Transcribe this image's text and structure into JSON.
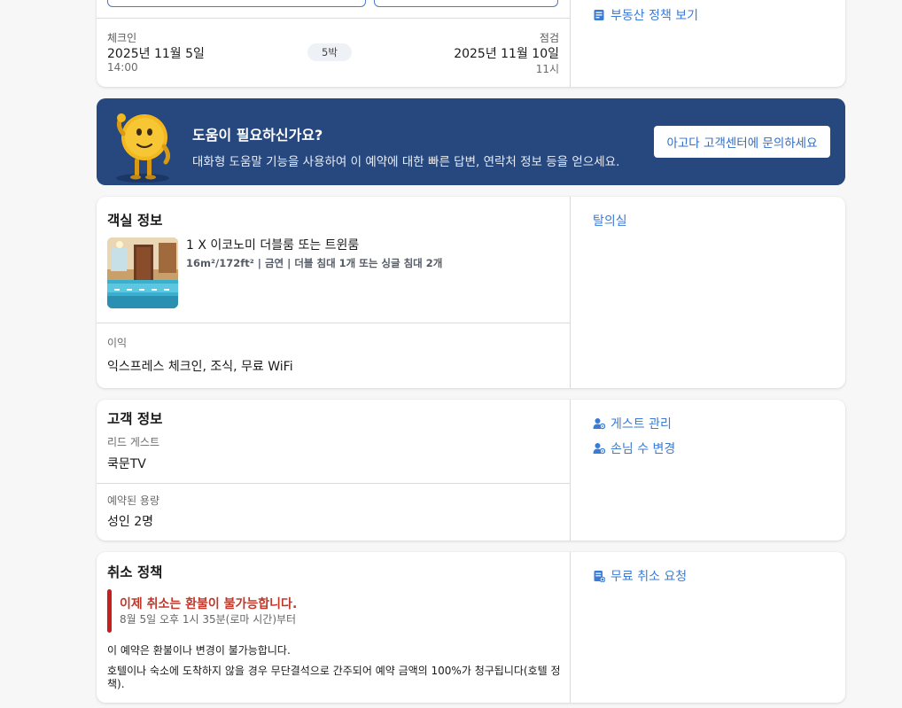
{
  "stay": {
    "property_policy_link": "부동산 정책 보기",
    "checkin_label": "체크인",
    "checkin_date": "2025년 11월 5일",
    "checkin_time": "14:00",
    "nights": "5박",
    "checkout_label": "점검",
    "checkout_date": "2025년 11월 10일",
    "checkout_time": "11시"
  },
  "help": {
    "title": "도움이 필요하신가요?",
    "description": "대화형 도움말 기능을 사용하여 이 예약에 대한 빠른 답변, 연락처 정보 등을 얻으세요.",
    "cta": "아고다 고객센터에 문의하세요"
  },
  "room": {
    "section_title": "객실 정보",
    "name": "1 X 이코노미 더블룸 또는 트윈룸",
    "spec": "16m²/172ft² | 금연 | 더블 침대 1개 또는 싱글 침대 2개",
    "benefits_label": "이익",
    "benefits": "익스프레스 체크인, 조식, 무료 WiFi",
    "side_link": "탈의실"
  },
  "guest": {
    "section_title": "고객 정보",
    "lead_label": "리드 게스트",
    "lead_name": "쿡문TV",
    "capacity_label": "예약된 용량",
    "capacity": "성인 2명",
    "manage_link": "게스트 관리",
    "change_count_link": "손님 수 변경"
  },
  "cancel": {
    "section_title": "취소 정책",
    "alert_title": "이제 취소는 환불이 불가능합니다.",
    "alert_sub": "8월 5일 오후 1시 35분(로마 시간)부터",
    "line1": "이 예약은 환불이나 변경이 불가능합니다.",
    "line2": "호텔이나 숙소에 도착하지 않을 경우 무단결석으로 간주되어 예약 금액의 100%가 청구됩니다(호텔 정책).",
    "free_cancel_link": "무료 취소 요청"
  },
  "colors": {
    "link": "#3a7bd5",
    "banner": "#26487e",
    "alert": "#c71e1e"
  }
}
